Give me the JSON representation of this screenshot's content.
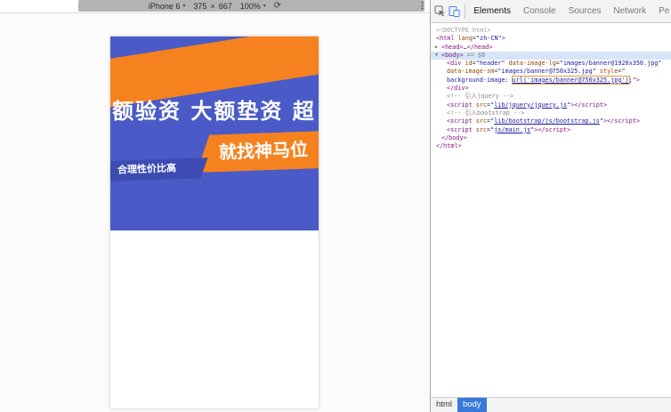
{
  "device_toolbar": {
    "device": "iPhone 6",
    "chevron": "▾",
    "width": "375",
    "times": "×",
    "height": "667",
    "zoom": "100%",
    "rotate_icon": "⟳",
    "more_icon": "⋮"
  },
  "page": {
    "banner": {
      "headline": "额验资 大额垫资 超",
      "ribbon_primary": "就找神马位",
      "ribbon_secondary": "合理性价比高"
    },
    "colors": {
      "banner_bg": "#4a5bc7",
      "banner_stripe": "#f6821f",
      "ribbon_indigo": "#3c4cb2"
    }
  },
  "devtools": {
    "tabs": [
      "Elements",
      "Console",
      "Sources",
      "Network",
      "Performance"
    ],
    "selected_tab": "Elements",
    "breadcrumbs": [
      "html",
      "body"
    ],
    "selected_crumb": "body",
    "code": [
      {
        "indent": 0,
        "parts": [
          {
            "t": "<!DOCTYPE html>",
            "c": "doc"
          }
        ]
      },
      {
        "indent": 0,
        "parts": [
          {
            "t": "<html ",
            "c": "tag"
          },
          {
            "t": "lang",
            "c": "attr"
          },
          {
            "t": "=",
            "c": "plain"
          },
          {
            "t": "\"zh-CN\"",
            "c": "val"
          },
          {
            "t": ">",
            "c": "tag"
          }
        ]
      },
      {
        "indent": 1,
        "arrow": "▶",
        "parts": [
          {
            "t": "<head>",
            "c": "tag"
          },
          {
            "t": "…",
            "c": "plain"
          },
          {
            "t": "</head>",
            "c": "tag"
          }
        ]
      },
      {
        "indent": 1,
        "arrow": "▼",
        "selected": true,
        "parts": [
          {
            "t": "<body>",
            "c": "tag"
          },
          {
            "t": " == $0",
            "c": "dollar"
          }
        ]
      },
      {
        "indent": 2,
        "parts": [
          {
            "t": "<div ",
            "c": "tag"
          },
          {
            "t": "id",
            "c": "attr"
          },
          {
            "t": "=",
            "c": "plain"
          },
          {
            "t": "\"header\"",
            "c": "val"
          },
          {
            "t": " ",
            "c": "plain"
          },
          {
            "t": "data-image-lg",
            "c": "attr"
          },
          {
            "t": "=",
            "c": "plain"
          },
          {
            "t": "\"images/banner@1920x350.jpg\"",
            "c": "val"
          }
        ]
      },
      {
        "indent": 2,
        "parts": [
          {
            "t": "data-image-sm",
            "c": "attr"
          },
          {
            "t": "=",
            "c": "plain"
          },
          {
            "t": "\"images/banner@750x325.jpg\"",
            "c": "val"
          },
          {
            "t": " ",
            "c": "plain"
          },
          {
            "t": "style",
            "c": "attr"
          },
          {
            "t": "=\"",
            "c": "plain"
          }
        ]
      },
      {
        "indent": 2,
        "parts": [
          {
            "t": "background-image: ",
            "c": "val"
          },
          {
            "t": "url('images/banner@750x325.jpg')",
            "c": "link",
            "box": true
          },
          {
            "t": ";",
            "c": "val"
          },
          {
            "t": "\"",
            "c": "plain"
          },
          {
            "t": ">",
            "c": "tag"
          }
        ]
      },
      {
        "indent": 2,
        "parts": [
          {
            "t": "</div>",
            "c": "tag"
          }
        ]
      },
      {
        "indent": 2,
        "parts": [
          {
            "t": "<!-- 引入jquery -->",
            "c": "cmt"
          }
        ]
      },
      {
        "indent": 2,
        "parts": [
          {
            "t": "<script ",
            "c": "tag"
          },
          {
            "t": "src",
            "c": "attr"
          },
          {
            "t": "=",
            "c": "plain"
          },
          {
            "t": "\"",
            "c": "val"
          },
          {
            "t": "lib/jquery/jquery.js",
            "c": "link"
          },
          {
            "t": "\"",
            "c": "val"
          },
          {
            "t": ">",
            "c": "tag"
          },
          {
            "t": "</script>",
            "c": "tag"
          }
        ]
      },
      {
        "indent": 2,
        "parts": [
          {
            "t": "<!-- 引入bootstrap -->",
            "c": "cmt"
          }
        ]
      },
      {
        "indent": 2,
        "parts": [
          {
            "t": "<script ",
            "c": "tag"
          },
          {
            "t": "src",
            "c": "attr"
          },
          {
            "t": "=",
            "c": "plain"
          },
          {
            "t": "\"",
            "c": "val"
          },
          {
            "t": "lib/bootstrap/js/bootstrap.js",
            "c": "link"
          },
          {
            "t": "\"",
            "c": "val"
          },
          {
            "t": ">",
            "c": "tag"
          },
          {
            "t": "</script>",
            "c": "tag"
          }
        ]
      },
      {
        "indent": 2,
        "parts": [
          {
            "t": "<script ",
            "c": "tag"
          },
          {
            "t": "src",
            "c": "attr"
          },
          {
            "t": "=",
            "c": "plain"
          },
          {
            "t": "\"",
            "c": "val"
          },
          {
            "t": "js/main.js",
            "c": "link"
          },
          {
            "t": "\"",
            "c": "val"
          },
          {
            "t": ">",
            "c": "tag"
          },
          {
            "t": "</script>",
            "c": "tag"
          }
        ]
      },
      {
        "indent": 1,
        "parts": [
          {
            "t": "</body>",
            "c": "tag"
          }
        ]
      },
      {
        "indent": 0,
        "parts": [
          {
            "t": "</html>",
            "c": "tag"
          }
        ]
      }
    ]
  }
}
